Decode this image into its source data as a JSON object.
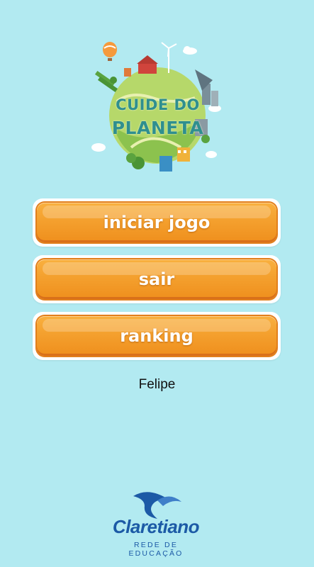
{
  "app": {
    "logo_line1": "CUIDE DO",
    "logo_line2": "PLANETA"
  },
  "menu": {
    "start_label": "iniciar jogo",
    "exit_label": "sair",
    "ranking_label": "ranking"
  },
  "player": {
    "name": "Felipe"
  },
  "footer": {
    "brand_name": "Claretiano",
    "brand_subtitle": "REDE DE EDUCAÇÃO"
  },
  "colors": {
    "background": "#b2eaf1",
    "button": "#f4a02e",
    "brand": "#1c5aa6"
  }
}
